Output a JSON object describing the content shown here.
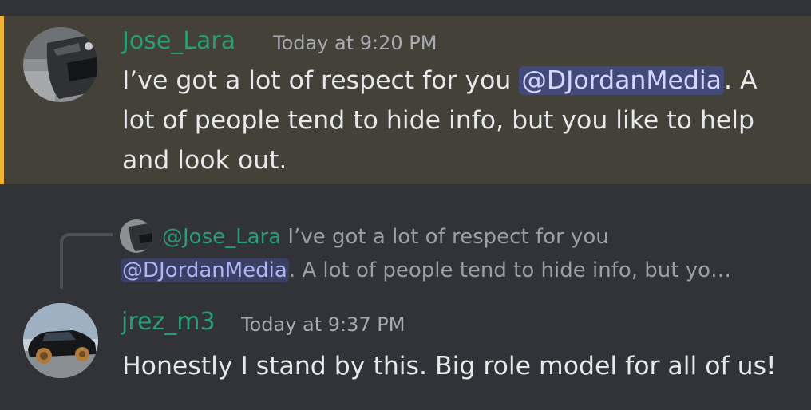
{
  "messages": [
    {
      "username": "Jose_Lara",
      "timestamp": "Today at 9:20 PM",
      "text_before": "I’ve got a lot of respect for you ",
      "mention": "@DJordanMedia",
      "text_after": ". A lot of people tend to hide info, but you like to help and look out.",
      "highlighted": true,
      "avatar_icon": "car-front-avatar"
    },
    {
      "username": "jrez_m3",
      "timestamp": "Today at 9:37 PM",
      "text": "Honestly I stand by this. Big role model for all of us!",
      "avatar_icon": "black-car-avatar",
      "reply": {
        "username": "@Jose_Lara",
        "line1": " I’ve got a lot of respect for you",
        "mention": "@DJordanMedia",
        "line2_after": ". A lot of people tend to hide info, but yo…"
      }
    }
  ],
  "colors": {
    "background": "#313338",
    "highlight_background": "#444139",
    "highlight_bar": "#f0b232",
    "username": "#2a9d72",
    "mention_bg": "#434a79"
  }
}
